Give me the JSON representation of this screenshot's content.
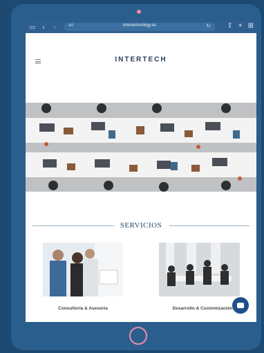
{
  "browser": {
    "text_size_label": "aA",
    "url": "intertechnology.es",
    "lock_glyph": "🔒",
    "icons": [
      "sidebar-icon",
      "back-icon",
      "forward-icon",
      "reload-icon",
      "share-icon",
      "new-tab-icon",
      "tabs-icon"
    ]
  },
  "site": {
    "logo_main": "INTERTECH",
    "logo_sub": "",
    "section_title": "SERVICIOS",
    "cards": [
      {
        "label": "Consultoría & Asesoría"
      },
      {
        "label": "Desarrollo & Customización"
      }
    ]
  },
  "colors": {
    "device_frame": "#2a5e8c",
    "background": "#1c4a73",
    "accent_pink": "#f08cab",
    "brand_navy": "#244a6c",
    "chat_button": "#1e4f8a"
  }
}
